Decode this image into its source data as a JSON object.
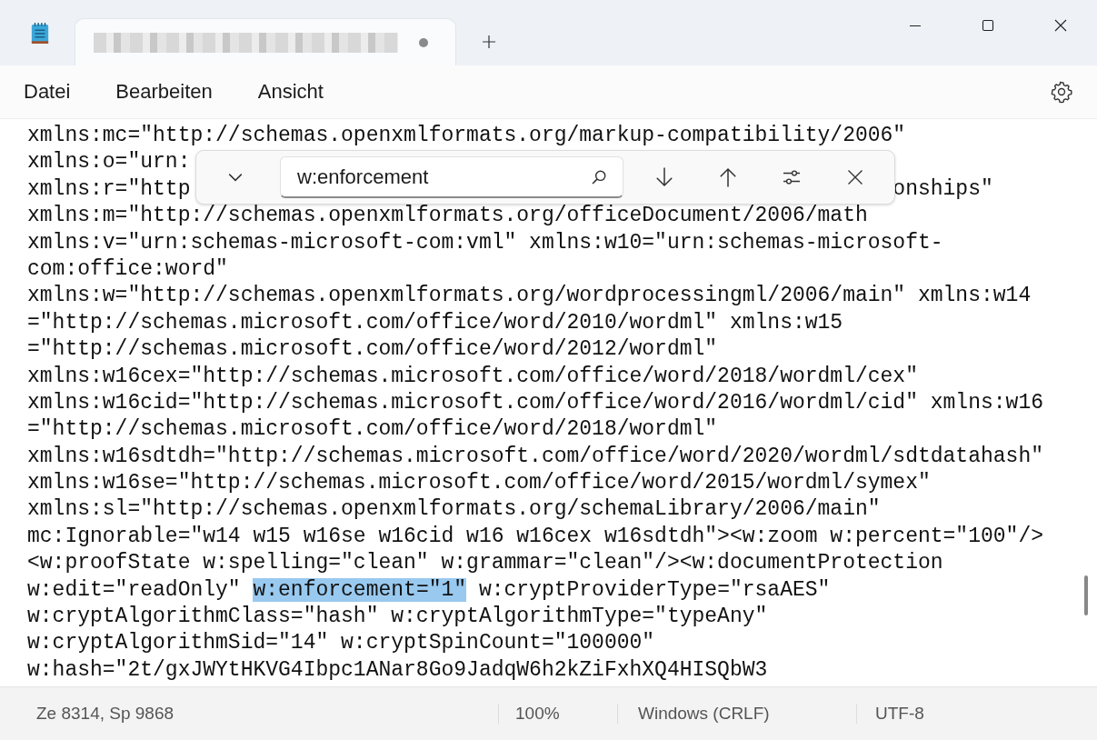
{
  "tabs": [
    {
      "modified": true,
      "selected": true
    }
  ],
  "menu": [
    "Datei",
    "Bearbeiten",
    "Ansicht"
  ],
  "find": {
    "value": "w:enforcement"
  },
  "lines": [
    {
      "segments": [
        {
          "text": "xmlns:mc=\"http://schemas.openxmlformats.org/markup-compatibility/2006\"",
          "highlighted": false
        }
      ]
    },
    {
      "segments": [
        {
          "text": "xmlns:o=\"urn:",
          "highlighted": false
        }
      ]
    },
    {
      "split": true,
      "segments": [
        {
          "text": "xmlns:r=\"http",
          "highlighted": false
        },
        {
          "text": "onships\"",
          "highlighted": false
        }
      ]
    },
    {
      "segments": [
        {
          "text": "xmlns:m=\"http://schemas.openxmlformats.org/officeDocument/2006/math",
          "highlighted": false
        }
      ]
    },
    {
      "segments": [
        {
          "text": "xmlns:v=\"urn:schemas-microsoft-com:vml\" xmlns:w10=\"urn:schemas-microsoft-",
          "highlighted": false
        }
      ]
    },
    {
      "segments": [
        {
          "text": "com:office:word\"",
          "highlighted": false
        }
      ]
    },
    {
      "segments": [
        {
          "text": "xmlns:w=\"http://schemas.openxmlformats.org/wordprocessingml/2006/main\" xmlns:w14",
          "highlighted": false
        }
      ]
    },
    {
      "segments": [
        {
          "text": "=\"http://schemas.microsoft.com/office/word/2010/wordml\" xmlns:w15",
          "highlighted": false
        }
      ]
    },
    {
      "segments": [
        {
          "text": "=\"http://schemas.microsoft.com/office/word/2012/wordml\"",
          "highlighted": false
        }
      ]
    },
    {
      "segments": [
        {
          "text": "xmlns:w16cex=\"http://schemas.microsoft.com/office/word/2018/wordml/cex\"",
          "highlighted": false
        }
      ]
    },
    {
      "segments": [
        {
          "text": "xmlns:w16cid=\"http://schemas.microsoft.com/office/word/2016/wordml/cid\" xmlns:w16",
          "highlighted": false
        }
      ]
    },
    {
      "segments": [
        {
          "text": "=\"http://schemas.microsoft.com/office/word/2018/wordml\"",
          "highlighted": false
        }
      ]
    },
    {
      "segments": [
        {
          "text": "xmlns:w16sdtdh=\"http://schemas.microsoft.com/office/word/2020/wordml/sdtdatahash\"",
          "highlighted": false
        }
      ]
    },
    {
      "segments": [
        {
          "text": "xmlns:w16se=\"http://schemas.microsoft.com/office/word/2015/wordml/symex\"",
          "highlighted": false
        }
      ]
    },
    {
      "segments": [
        {
          "text": "xmlns:sl=\"http://schemas.openxmlformats.org/schemaLibrary/2006/main\"",
          "highlighted": false
        }
      ]
    },
    {
      "segments": [
        {
          "text": "mc:Ignorable=\"w14 w15 w16se w16cid w16 w16cex w16sdtdh\"><w:zoom w:percent=\"100\"/>",
          "highlighted": false
        }
      ]
    },
    {
      "segments": [
        {
          "text": "<w:proofState w:spelling=\"clean\" w:grammar=\"clean\"/><w:documentProtection",
          "highlighted": false
        }
      ]
    },
    {
      "segments": [
        {
          "text": "w:edit=\"readOnly\" ",
          "highlighted": false
        },
        {
          "text": "w:enforcement=\"1\"",
          "highlighted": true
        },
        {
          "text": " w:cryptProviderType=\"rsaAES\"",
          "highlighted": false
        }
      ]
    },
    {
      "segments": [
        {
          "text": "w:cryptAlgorithmClass=\"hash\" w:cryptAlgorithmType=\"typeAny\"",
          "highlighted": false
        }
      ]
    },
    {
      "segments": [
        {
          "text": "w:cryptAlgorithmSid=\"14\" w:cryptSpinCount=\"100000\"",
          "highlighted": false
        }
      ]
    },
    {
      "segments": [
        {
          "text": "w:hash=\"2t/gxJWYtHKVG4Ibpc1ANar8Go9JadqW6h2kZiFxhXQ4HISQbW3",
          "highlighted": false
        }
      ]
    }
  ],
  "status_bar": [
    "Ze 8314, Sp 9868",
    "100%",
    "Windows (CRLF)",
    "UTF-8"
  ]
}
